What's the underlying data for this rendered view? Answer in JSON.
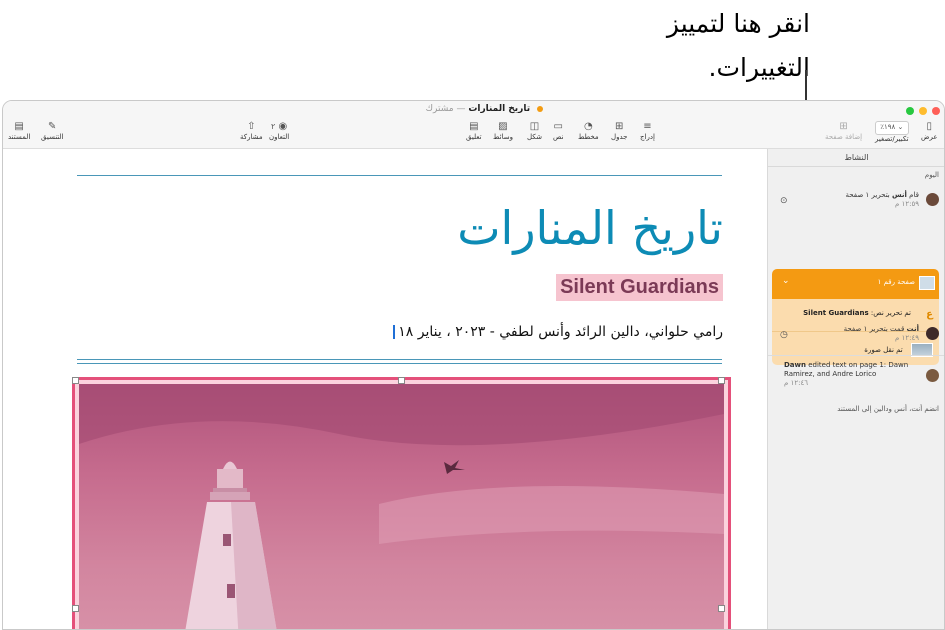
{
  "callout": {
    "line1": "انقر هنا لتمييز",
    "line2": "التغييرات."
  },
  "window": {
    "title": "تاريخ المنارات",
    "title_separator": "—",
    "shared_label": "مشترك"
  },
  "toolbar": {
    "view": "عرض",
    "zoom_value": "٪١٩٨",
    "zoom_label": "تكبير/تصغير",
    "add_page": "إضافة صفحة",
    "insert": "إدراج",
    "table": "جدول",
    "chart": "مخطط",
    "text": "نص",
    "shape": "شكل",
    "media": "وسائط",
    "comment": "تعليق",
    "collaborate_count": "٢",
    "collaborate": "التعاون",
    "share": "مشاركة",
    "format": "التنسيق",
    "document": "المستند"
  },
  "sidebar": {
    "title": "النشاط",
    "today": "اليوم",
    "entry1": {
      "prefix": "قام",
      "name": "أنس",
      "text": "بتحرير ١ صفحة",
      "time": "١٢:٥٩ م"
    },
    "page_group": {
      "label": "صفحة رقم ١"
    },
    "edit_text": {
      "label": "تم تحرير نص:",
      "value": "Silent Guardians"
    },
    "move_image": {
      "label": "تم نقل صورة"
    },
    "entry2": {
      "name": "أنت",
      "text": "قمت بتحرير ١ صفحة",
      "time": "١٢:٤٩ م"
    },
    "entry3": {
      "name": "Dawn",
      "text": "edited text on page 1: Dawn Ramirez, and Andre Lorico",
      "time": "١٢:٤٦ م"
    },
    "joined": "انضم أنت، أنس ودالين إلى المستند"
  },
  "document": {
    "title": "تاريخ المنارات",
    "subtitle": "Silent Guardians",
    "authors": "رامي حلواني، دالين الرائد وأنس لطفي - ٢٠٢٣ ، يناير ١٨"
  },
  "colors": {
    "accent_orange": "#f49a12",
    "title_blue": "#0d8bb5",
    "highlight_pink": "#f6c4cf",
    "selection_red": "#e4507a"
  }
}
